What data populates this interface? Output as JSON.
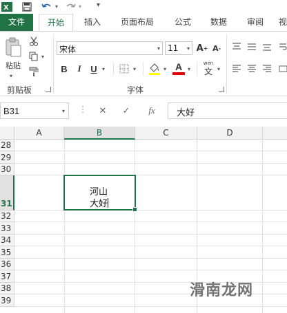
{
  "title_bar": {
    "icons": [
      "excel-logo-icon",
      "save-icon",
      "undo-icon",
      "redo-icon",
      "customize-quick-access-icon"
    ]
  },
  "tabs": [
    {
      "label": "文件",
      "active": false
    },
    {
      "label": "开始",
      "active": true
    },
    {
      "label": "插入",
      "active": false
    },
    {
      "label": "页面布局",
      "active": false
    },
    {
      "label": "公式",
      "active": false
    },
    {
      "label": "数据",
      "active": false
    },
    {
      "label": "审阅",
      "active": false
    },
    {
      "label": "视",
      "active": false
    }
  ],
  "ribbon": {
    "clipboard": {
      "group_label": "剪贴板",
      "paste_label": "粘贴"
    },
    "font": {
      "group_label": "字体",
      "font_name": "宋体",
      "font_size": "11",
      "bold": "B",
      "italic": "I",
      "underline": "U",
      "font_color_letter": "A",
      "wen_label": "wén",
      "wen_char": "文"
    },
    "accent_color": "#217346",
    "font_color_bar": "#e00000"
  },
  "formula_bar": {
    "name_box": "B31",
    "cancel": "✕",
    "enter": "✓",
    "fx": "fx",
    "content": "大好"
  },
  "sheet": {
    "columns": [
      "A",
      "B",
      "C",
      "D"
    ],
    "selected_column": "B",
    "rows": [
      "28",
      "29",
      "30",
      "31",
      "32",
      "33",
      "34",
      "35",
      "36",
      "37",
      "38",
      "39"
    ],
    "selected_row": "31",
    "active_cell": {
      "ref": "B31",
      "line1": "河山",
      "line2": "大好"
    }
  },
  "watermark": "滑南龙网"
}
